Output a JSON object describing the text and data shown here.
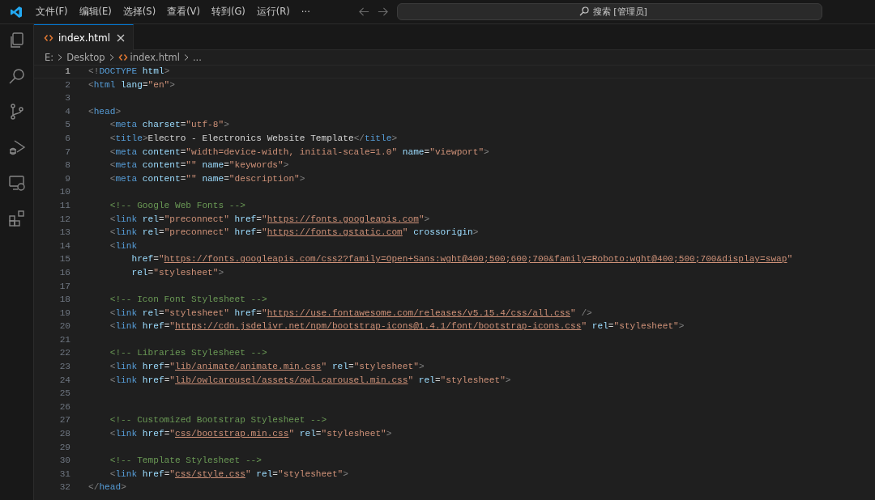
{
  "menu": [
    "文件(F)",
    "编辑(E)",
    "选择(S)",
    "查看(V)",
    "转到(G)",
    "运行(R)",
    "···"
  ],
  "search": {
    "placeholder": "搜索 [管理员]"
  },
  "tabs": [
    {
      "label": "index.html",
      "selected": true
    }
  ],
  "breadcrumbs": [
    "E:",
    "Desktop",
    "index.html",
    "..."
  ],
  "lines": [
    {
      "number": "1",
      "current": true,
      "tokens": [
        {
          "kind": "punct",
          "text": "<!"
        },
        {
          "kind": "tag",
          "text": "DOCTYPE"
        },
        {
          "kind": "attr",
          "text": " html"
        },
        {
          "kind": "punct",
          "text": ">"
        }
      ]
    },
    {
      "number": "2",
      "current": false,
      "tokens": [
        {
          "kind": "punct",
          "text": "<"
        },
        {
          "kind": "tag",
          "text": "html"
        },
        {
          "kind": "attr",
          "text": " lang"
        },
        {
          "kind": "eq",
          "text": "="
        },
        {
          "kind": "str",
          "text": "\"en\""
        },
        {
          "kind": "punct",
          "text": ">"
        }
      ]
    },
    {
      "number": "3",
      "current": false
    },
    {
      "number": "4",
      "current": false,
      "tokens": [
        {
          "kind": "punct",
          "text": "<"
        },
        {
          "kind": "tag",
          "text": "head"
        },
        {
          "kind": "punct",
          "text": ">"
        }
      ]
    },
    {
      "number": "5",
      "current": false,
      "tokens": [
        {
          "kind": "punct",
          "text": "    <"
        },
        {
          "kind": "tag",
          "text": "meta"
        },
        {
          "kind": "attr",
          "text": " charset"
        },
        {
          "kind": "eq",
          "text": "="
        },
        {
          "kind": "str",
          "text": "\"utf-8\""
        },
        {
          "kind": "punct",
          "text": ">"
        }
      ]
    },
    {
      "number": "6",
      "current": false,
      "tokens": [
        {
          "kind": "punct",
          "text": "    <"
        },
        {
          "kind": "tag",
          "text": "title"
        },
        {
          "kind": "punct",
          "text": ">"
        },
        {
          "kind": "text",
          "text": "Electro - Electronics Website Template"
        },
        {
          "kind": "punct",
          "text": "</"
        },
        {
          "kind": "tag",
          "text": "title"
        },
        {
          "kind": "punct",
          "text": ">"
        }
      ]
    },
    {
      "number": "7",
      "current": false,
      "tokens": [
        {
          "kind": "punct",
          "text": "    <"
        },
        {
          "kind": "tag",
          "text": "meta"
        },
        {
          "kind": "attr",
          "text": " content"
        },
        {
          "kind": "eq",
          "text": "="
        },
        {
          "kind": "str",
          "text": "\"width=device-width, initial-scale=1.0\""
        },
        {
          "kind": "attr",
          "text": " name"
        },
        {
          "kind": "eq",
          "text": "="
        },
        {
          "kind": "str",
          "text": "\"viewport\""
        },
        {
          "kind": "punct",
          "text": ">"
        }
      ]
    },
    {
      "number": "8",
      "current": false,
      "tokens": [
        {
          "kind": "punct",
          "text": "    <"
        },
        {
          "kind": "tag",
          "text": "meta"
        },
        {
          "kind": "attr",
          "text": " content"
        },
        {
          "kind": "eq",
          "text": "="
        },
        {
          "kind": "str",
          "text": "\"\""
        },
        {
          "kind": "attr",
          "text": " name"
        },
        {
          "kind": "eq",
          "text": "="
        },
        {
          "kind": "str",
          "text": "\"keywords\""
        },
        {
          "kind": "punct",
          "text": ">"
        }
      ]
    },
    {
      "number": "9",
      "current": false,
      "tokens": [
        {
          "kind": "punct",
          "text": "    <"
        },
        {
          "kind": "tag",
          "text": "meta"
        },
        {
          "kind": "attr",
          "text": " content"
        },
        {
          "kind": "eq",
          "text": "="
        },
        {
          "kind": "str",
          "text": "\"\""
        },
        {
          "kind": "attr",
          "text": " name"
        },
        {
          "kind": "eq",
          "text": "="
        },
        {
          "kind": "str",
          "text": "\"description\""
        },
        {
          "kind": "punct",
          "text": ">"
        }
      ]
    },
    {
      "number": "10",
      "current": false
    },
    {
      "number": "11",
      "current": false,
      "tokens": [
        {
          "kind": "comment",
          "text": "    <!-- Google Web Fonts -->"
        }
      ]
    },
    {
      "number": "12",
      "current": false,
      "tokens": [
        {
          "kind": "punct",
          "text": "    <"
        },
        {
          "kind": "tag",
          "text": "link"
        },
        {
          "kind": "attr",
          "text": " rel"
        },
        {
          "kind": "eq",
          "text": "="
        },
        {
          "kind": "str",
          "text": "\"preconnect\""
        },
        {
          "kind": "attr",
          "text": " href"
        },
        {
          "kind": "eq",
          "text": "="
        },
        {
          "kind": "str",
          "text": "\""
        },
        {
          "kind": "link",
          "text": "https://fonts.googleapis.com"
        },
        {
          "kind": "str",
          "text": "\""
        },
        {
          "kind": "punct",
          "text": ">"
        }
      ]
    },
    {
      "number": "13",
      "current": false,
      "tokens": [
        {
          "kind": "punct",
          "text": "    <"
        },
        {
          "kind": "tag",
          "text": "link"
        },
        {
          "kind": "attr",
          "text": " rel"
        },
        {
          "kind": "eq",
          "text": "="
        },
        {
          "kind": "str",
          "text": "\"preconnect\""
        },
        {
          "kind": "attr",
          "text": " href"
        },
        {
          "kind": "eq",
          "text": "="
        },
        {
          "kind": "str",
          "text": "\""
        },
        {
          "kind": "link",
          "text": "https://fonts.gstatic.com"
        },
        {
          "kind": "str",
          "text": "\""
        },
        {
          "kind": "attr",
          "text": " crossorigin"
        },
        {
          "kind": "punct",
          "text": ">"
        }
      ]
    },
    {
      "number": "14",
      "current": false,
      "tokens": [
        {
          "kind": "punct",
          "text": "    <"
        },
        {
          "kind": "tag",
          "text": "link"
        }
      ]
    },
    {
      "number": "15",
      "current": false,
      "tokens": [
        {
          "kind": "attr",
          "text": "        href"
        },
        {
          "kind": "eq",
          "text": "="
        },
        {
          "kind": "str",
          "text": "\""
        },
        {
          "kind": "link",
          "text": "https://fonts.googleapis.com/css2?family=Open+Sans:wght@400;500;600;700&family=Roboto:wght@400;500;700&display=swap"
        },
        {
          "kind": "str",
          "text": "\""
        }
      ]
    },
    {
      "number": "16",
      "current": false,
      "tokens": [
        {
          "kind": "attr",
          "text": "        rel"
        },
        {
          "kind": "eq",
          "text": "="
        },
        {
          "kind": "str",
          "text": "\"stylesheet\""
        },
        {
          "kind": "punct",
          "text": ">"
        }
      ]
    },
    {
      "number": "17",
      "current": false
    },
    {
      "number": "18",
      "current": false,
      "tokens": [
        {
          "kind": "comment",
          "text": "    <!-- Icon Font Stylesheet -->"
        }
      ]
    },
    {
      "number": "19",
      "current": false,
      "tokens": [
        {
          "kind": "punct",
          "text": "    <"
        },
        {
          "kind": "tag",
          "text": "link"
        },
        {
          "kind": "attr",
          "text": " rel"
        },
        {
          "kind": "eq",
          "text": "="
        },
        {
          "kind": "str",
          "text": "\"stylesheet\""
        },
        {
          "kind": "attr",
          "text": " href"
        },
        {
          "kind": "eq",
          "text": "="
        },
        {
          "kind": "str",
          "text": "\""
        },
        {
          "kind": "link",
          "text": "https://use.fontawesome.com/releases/v5.15.4/css/all.css"
        },
        {
          "kind": "str",
          "text": "\""
        },
        {
          "kind": "punct",
          "text": " />"
        }
      ]
    },
    {
      "number": "20",
      "current": false,
      "tokens": [
        {
          "kind": "punct",
          "text": "    <"
        },
        {
          "kind": "tag",
          "text": "link"
        },
        {
          "kind": "attr",
          "text": " href"
        },
        {
          "kind": "eq",
          "text": "="
        },
        {
          "kind": "str",
          "text": "\""
        },
        {
          "kind": "link",
          "text": "https://cdn.jsdelivr.net/npm/bootstrap-icons@1.4.1/font/bootstrap-icons.css"
        },
        {
          "kind": "str",
          "text": "\""
        },
        {
          "kind": "attr",
          "text": " rel"
        },
        {
          "kind": "eq",
          "text": "="
        },
        {
          "kind": "str",
          "text": "\"stylesheet\""
        },
        {
          "kind": "punct",
          "text": ">"
        }
      ]
    },
    {
      "number": "21",
      "current": false
    },
    {
      "number": "22",
      "current": false,
      "tokens": [
        {
          "kind": "comment",
          "text": "    <!-- Libraries Stylesheet -->"
        }
      ]
    },
    {
      "number": "23",
      "current": false,
      "tokens": [
        {
          "kind": "punct",
          "text": "    <"
        },
        {
          "kind": "tag",
          "text": "link"
        },
        {
          "kind": "attr",
          "text": " href"
        },
        {
          "kind": "eq",
          "text": "="
        },
        {
          "kind": "str",
          "text": "\""
        },
        {
          "kind": "link",
          "text": "lib/animate/animate.min.css"
        },
        {
          "kind": "str",
          "text": "\""
        },
        {
          "kind": "attr",
          "text": " rel"
        },
        {
          "kind": "eq",
          "text": "="
        },
        {
          "kind": "str",
          "text": "\"stylesheet\""
        },
        {
          "kind": "punct",
          "text": ">"
        }
      ]
    },
    {
      "number": "24",
      "current": false,
      "tokens": [
        {
          "kind": "punct",
          "text": "    <"
        },
        {
          "kind": "tag",
          "text": "link"
        },
        {
          "kind": "attr",
          "text": " href"
        },
        {
          "kind": "eq",
          "text": "="
        },
        {
          "kind": "str",
          "text": "\""
        },
        {
          "kind": "link",
          "text": "lib/owlcarousel/assets/owl.carousel.min.css"
        },
        {
          "kind": "str",
          "text": "\""
        },
        {
          "kind": "attr",
          "text": " rel"
        },
        {
          "kind": "eq",
          "text": "="
        },
        {
          "kind": "str",
          "text": "\"stylesheet\""
        },
        {
          "kind": "punct",
          "text": ">"
        }
      ]
    },
    {
      "number": "25",
      "current": false
    },
    {
      "number": "26",
      "current": false
    },
    {
      "number": "27",
      "current": false,
      "tokens": [
        {
          "kind": "comment",
          "text": "    <!-- Customized Bootstrap Stylesheet -->"
        }
      ]
    },
    {
      "number": "28",
      "current": false,
      "tokens": [
        {
          "kind": "punct",
          "text": "    <"
        },
        {
          "kind": "tag",
          "text": "link"
        },
        {
          "kind": "attr",
          "text": " href"
        },
        {
          "kind": "eq",
          "text": "="
        },
        {
          "kind": "str",
          "text": "\""
        },
        {
          "kind": "link",
          "text": "css/bootstrap.min.css"
        },
        {
          "kind": "str",
          "text": "\""
        },
        {
          "kind": "attr",
          "text": " rel"
        },
        {
          "kind": "eq",
          "text": "="
        },
        {
          "kind": "str",
          "text": "\"stylesheet\""
        },
        {
          "kind": "punct",
          "text": ">"
        }
      ]
    },
    {
      "number": "29",
      "current": false
    },
    {
      "number": "30",
      "current": false,
      "tokens": [
        {
          "kind": "comment",
          "text": "    <!-- Template Stylesheet -->"
        }
      ]
    },
    {
      "number": "31",
      "current": false,
      "tokens": [
        {
          "kind": "punct",
          "text": "    <"
        },
        {
          "kind": "tag",
          "text": "link"
        },
        {
          "kind": "attr",
          "text": " href"
        },
        {
          "kind": "eq",
          "text": "="
        },
        {
          "kind": "str",
          "text": "\""
        },
        {
          "kind": "link",
          "text": "css/style.css"
        },
        {
          "kind": "str",
          "text": "\""
        },
        {
          "kind": "attr",
          "text": " rel"
        },
        {
          "kind": "eq",
          "text": "="
        },
        {
          "kind": "str",
          "text": "\"stylesheet\""
        },
        {
          "kind": "punct",
          "text": ">"
        }
      ]
    },
    {
      "number": "32",
      "current": false,
      "tokens": [
        {
          "kind": "punct",
          "text": "</"
        },
        {
          "kind": "tag",
          "text": "head"
        },
        {
          "kind": "punct",
          "text": ">"
        }
      ]
    }
  ]
}
